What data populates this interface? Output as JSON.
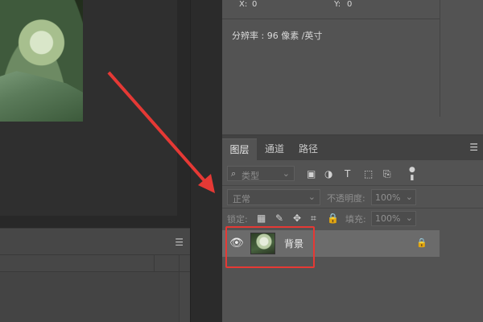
{
  "info": {
    "x_label": "X:",
    "x_value": "0",
    "y_label": "Y:",
    "y_value": "0",
    "resolution": "分辨率 : 96 像素 /英寸"
  },
  "tabs": [
    {
      "label": "图层"
    },
    {
      "label": "通道"
    },
    {
      "label": "路径"
    }
  ],
  "filter": {
    "label": "类型",
    "search_icon": "search-icon",
    "icons": [
      "image-filter-icon",
      "adjustment-filter-icon",
      "type-filter-icon",
      "shape-filter-icon",
      "smartobject-filter-icon",
      "filter-toggle-icon"
    ]
  },
  "blend": {
    "mode": "正常",
    "opacity_label": "不透明度:",
    "opacity_value": "100%"
  },
  "lock": {
    "label": "锁定:",
    "fill_label": "填充:",
    "fill_value": "100%"
  },
  "layer": {
    "name": "背景"
  },
  "colors": {
    "highlight": "#e53935",
    "arrow": "#e53935"
  }
}
